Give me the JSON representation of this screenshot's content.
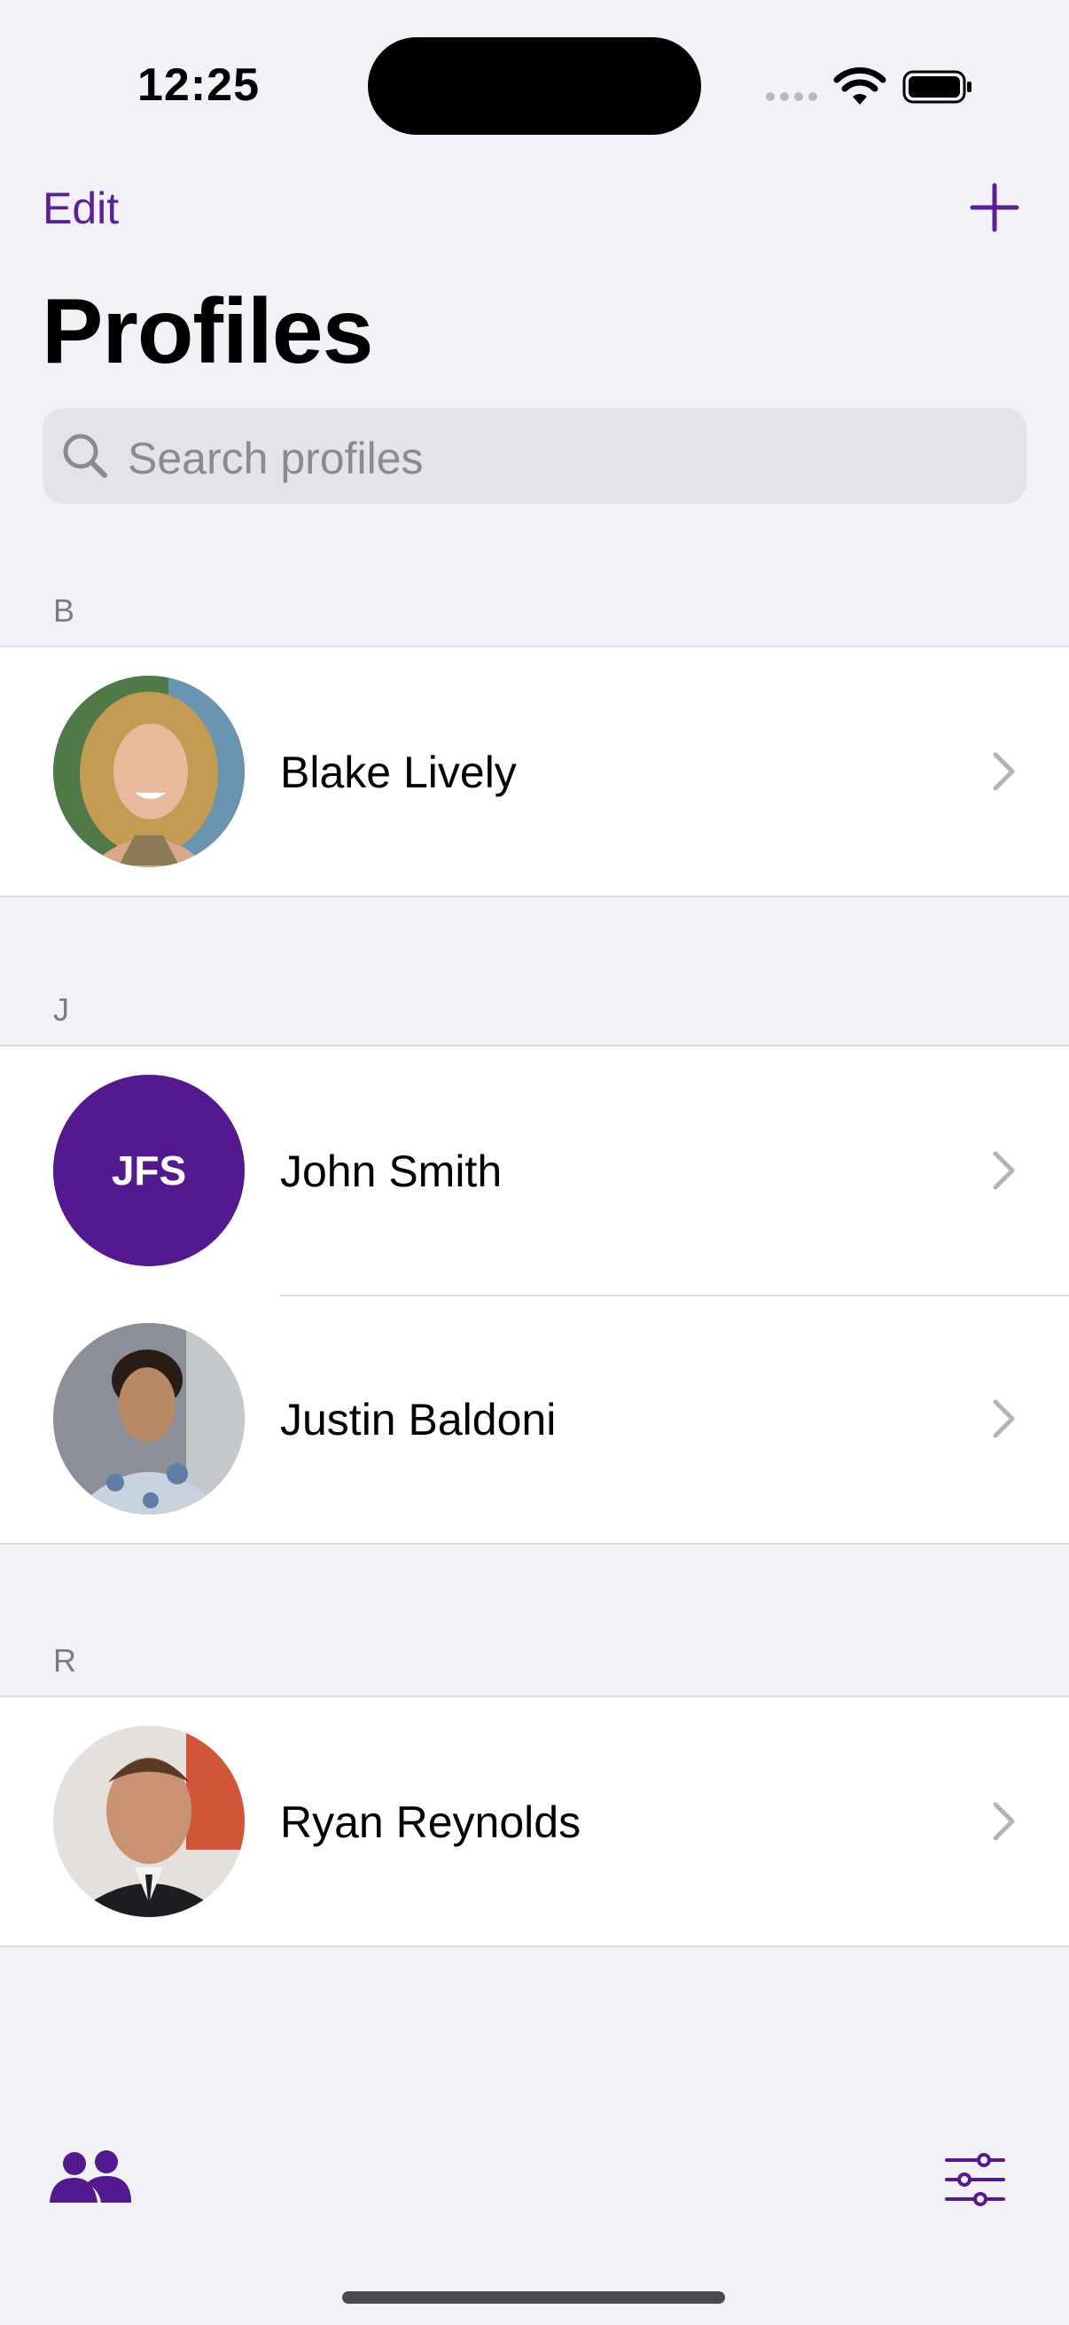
{
  "status_bar": {
    "time": "12:25"
  },
  "nav": {
    "edit_label": "Edit",
    "add_icon": "plus-icon",
    "title": "Profiles"
  },
  "search": {
    "placeholder": "Search profiles",
    "icon": "search-icon"
  },
  "sections": [
    {
      "letter": "B",
      "profiles": [
        {
          "name": "Blake Lively",
          "avatar": "photo"
        }
      ]
    },
    {
      "letter": "J",
      "profiles": [
        {
          "name": "John Smith",
          "avatar": "initials",
          "initials": "JFS"
        },
        {
          "name": "Justin Baldoni",
          "avatar": "photo"
        }
      ]
    },
    {
      "letter": "R",
      "profiles": [
        {
          "name": "Ryan Reynolds",
          "avatar": "photo"
        }
      ]
    }
  ],
  "tab_bar": {
    "left_icon": "people-icon",
    "right_icon": "sliders-icon"
  },
  "colors": {
    "accent": "#5b1f96",
    "background": "#f2f1f7",
    "initials_avatar": "#54198f"
  }
}
